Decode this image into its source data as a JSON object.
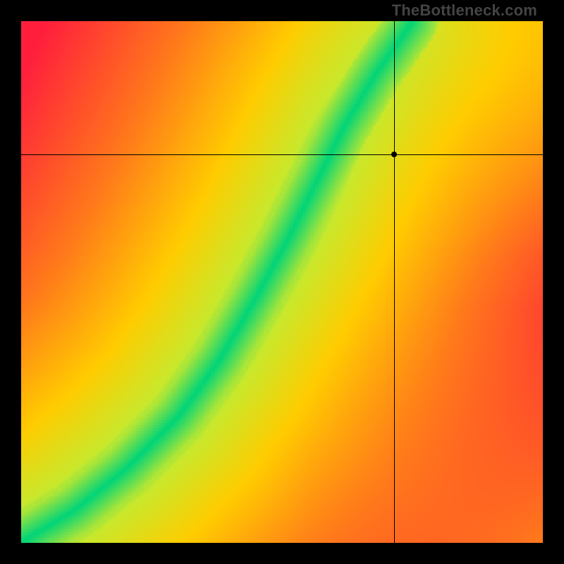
{
  "watermark": "TheBottleneck.com",
  "chart_data": {
    "type": "heatmap",
    "title": "",
    "xlabel": "",
    "ylabel": "",
    "xlim": [
      0,
      1
    ],
    "ylim": [
      0,
      1
    ],
    "colormap": {
      "description": "green→yellow→orange→red as distance from optimal curve increases; far corners fade toward yellow",
      "stops": [
        {
          "t": 0.0,
          "color": "#00d478"
        },
        {
          "t": 0.1,
          "color": "#c8e82c"
        },
        {
          "t": 0.3,
          "color": "#ffcc00"
        },
        {
          "t": 0.6,
          "color": "#ff7a1a"
        },
        {
          "t": 1.0,
          "color": "#ff1f3c"
        }
      ]
    },
    "optimal_curve": {
      "description": "green ridge — approximate (x,y) samples, coords as fractions of plot area from bottom-left",
      "points": [
        {
          "x": 0.0,
          "y": 0.0
        },
        {
          "x": 0.1,
          "y": 0.06
        },
        {
          "x": 0.2,
          "y": 0.14
        },
        {
          "x": 0.3,
          "y": 0.24
        },
        {
          "x": 0.38,
          "y": 0.35
        },
        {
          "x": 0.45,
          "y": 0.47
        },
        {
          "x": 0.51,
          "y": 0.58
        },
        {
          "x": 0.56,
          "y": 0.68
        },
        {
          "x": 0.62,
          "y": 0.8
        },
        {
          "x": 0.68,
          "y": 0.9
        },
        {
          "x": 0.75,
          "y": 1.0
        }
      ],
      "half_width_frac": 0.05
    },
    "marker": {
      "x_frac": 0.715,
      "y_frac": 0.745,
      "comment": "black dot with full-span crosshair; fractions from bottom-left of plot area"
    },
    "secondary_gradient": {
      "description": "global radial warming toward top-right and bottom-left softens red corners toward yellow"
    }
  }
}
